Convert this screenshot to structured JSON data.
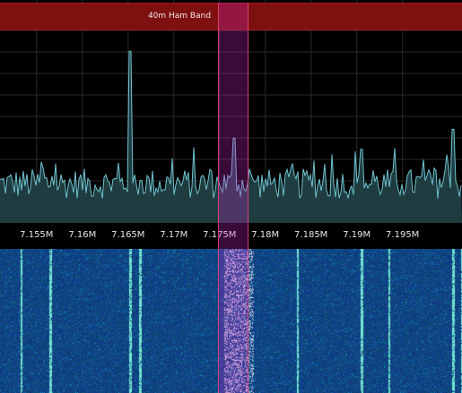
{
  "band_plan": {
    "label": "40m Ham Band",
    "color": "#7e1010"
  },
  "axis": {
    "ticks": [
      "7.155M",
      "7.16M",
      "7.165M",
      "7.17M",
      "7.175M",
      "7.18M",
      "7.185M",
      "7.19M",
      "7.195M"
    ]
  },
  "frequency_range_mhz": [
    7.151,
    7.2015
  ],
  "vfo": {
    "center_mhz": 7.1765,
    "bandwidth_khz": 3.3
  },
  "colors": {
    "trace": "#6fc3cf",
    "fill": "#1f3c40",
    "waterfall_bg": "#0f3a7a",
    "grid": "#2a2a2a"
  },
  "peaks": [
    {
      "freq_mhz": 7.1652,
      "level": 0.77
    },
    {
      "freq_mhz": 7.1765,
      "level": 0.38
    },
    {
      "freq_mhz": 7.1905,
      "level": 0.33
    },
    {
      "freq_mhz": 7.2005,
      "level": 0.42
    }
  ]
}
